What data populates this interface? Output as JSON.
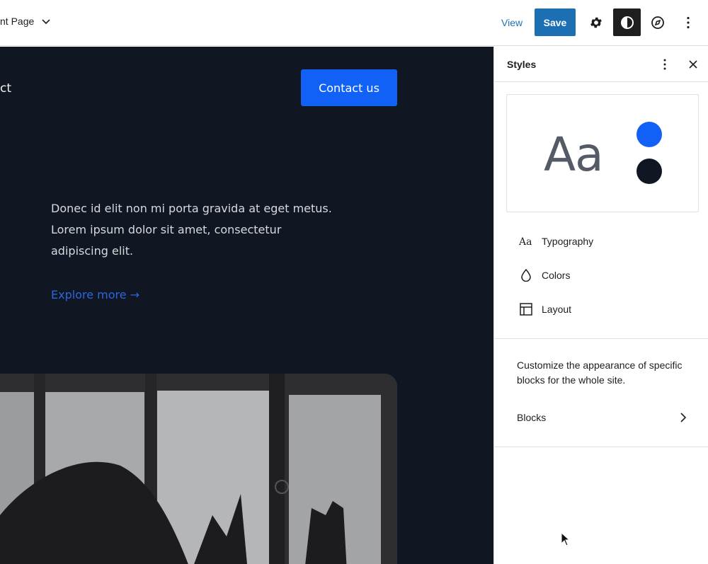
{
  "topbar": {
    "doc_title": "nt Page",
    "view_label": "View",
    "save_label": "Save"
  },
  "canvas": {
    "nav_fragment": "ct",
    "contact_label": "Contact us",
    "hero_text": "Donec id elit non mi porta gravida at eget metus. Lorem ipsum dolor sit amet, consectetur adipiscing elit.",
    "explore_label": "Explore more →"
  },
  "sidebar": {
    "title": "Styles",
    "preview_text": "Aa",
    "preview_colors": [
      "#1261f6",
      "#111722"
    ],
    "items": [
      {
        "label": "Typography",
        "icon": "typography-icon"
      },
      {
        "label": "Colors",
        "icon": "droplet-icon"
      },
      {
        "label": "Layout",
        "icon": "layout-icon"
      }
    ],
    "blocks_description": "Customize the appearance of specific blocks for the whole site.",
    "blocks_label": "Blocks"
  },
  "colors": {
    "accent": "#1c6fb3",
    "canvas_bg": "#111722",
    "brand_blue": "#1261f6"
  }
}
